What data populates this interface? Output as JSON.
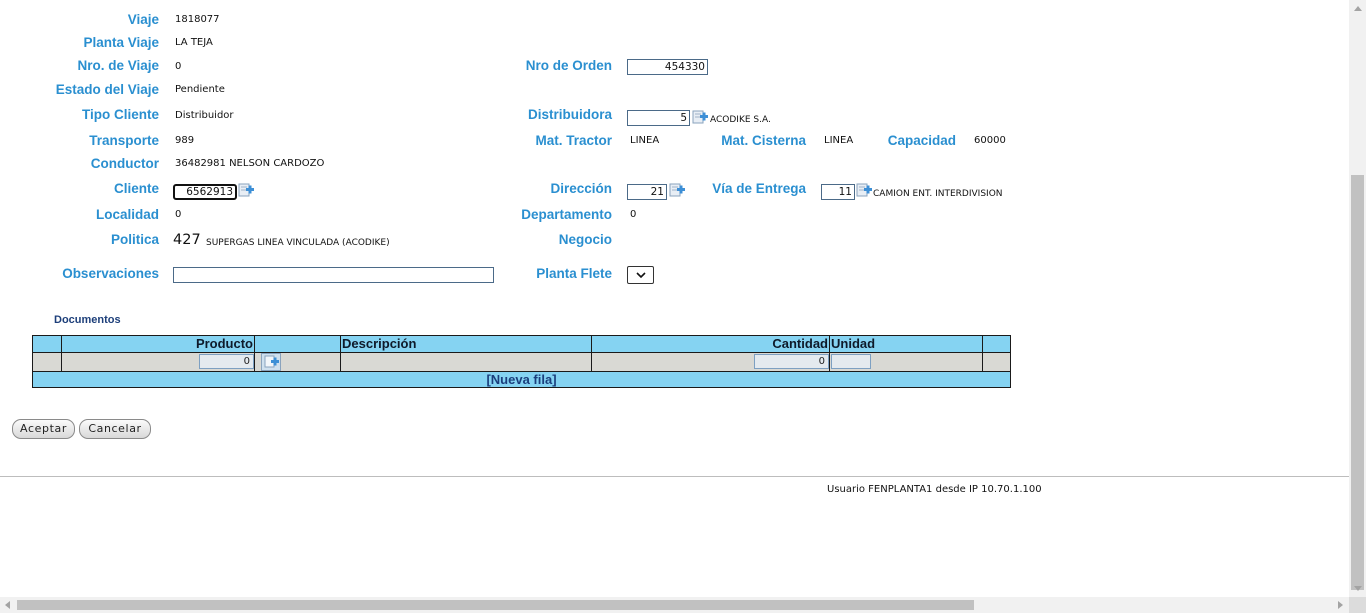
{
  "form": {
    "viaje": {
      "label": "Viaje",
      "value": "1818077"
    },
    "planta_viaje": {
      "label": "Planta Viaje",
      "value": "LA TEJA"
    },
    "nro_viaje": {
      "label": "Nro. de Viaje",
      "value": "0"
    },
    "nro_orden": {
      "label": "Nro de Orden",
      "value": "454330"
    },
    "estado": {
      "label": "Estado del Viaje",
      "value": "Pendiente"
    },
    "tipo_cliente": {
      "label": "Tipo Cliente",
      "value": "Distribuidor"
    },
    "distribuidora": {
      "label": "Distribuidora",
      "value": "5",
      "name": "ACODIKE S.A."
    },
    "transporte": {
      "label": "Transporte",
      "value": "989"
    },
    "mat_tractor": {
      "label": "Mat. Tractor",
      "value": "LINEA"
    },
    "mat_cisterna": {
      "label": "Mat. Cisterna",
      "value": "LINEA"
    },
    "capacidad": {
      "label": "Capacidad",
      "value": "60000"
    },
    "conductor": {
      "label": "Conductor",
      "value": "36482981 NELSON CARDOZO"
    },
    "cliente": {
      "label": "Cliente",
      "value": "6562913"
    },
    "direccion": {
      "label": "Dirección",
      "value": "21"
    },
    "via_entrega": {
      "label": "Vía de Entrega",
      "value": "11",
      "name": "CAMION ENT. INTERDIVISION"
    },
    "localidad": {
      "label": "Localidad",
      "value": "0"
    },
    "departamento": {
      "label": "Departamento",
      "value": "0"
    },
    "politica": {
      "label": "Politica",
      "code": "427",
      "name": "SUPERGAS LINEA VINCULADA (ACODIKE)"
    },
    "negocio": {
      "label": "Negocio",
      "value": ""
    },
    "observaciones": {
      "label": "Observaciones",
      "value": ""
    },
    "planta_flete": {
      "label": "Planta Flete",
      "selected": ""
    }
  },
  "documentos": {
    "title": "Documentos",
    "columns": {
      "producto": "Producto",
      "descripcion": "Descripción",
      "cantidad": "Cantidad",
      "unidad": "Unidad"
    },
    "rows": [
      {
        "producto": "0",
        "descripcion": "",
        "cantidad": "0",
        "unidad": ""
      }
    ],
    "new_row_label": "[Nueva fila]"
  },
  "buttons": {
    "accept": "Aceptar",
    "cancel": "Cancelar"
  },
  "footer": {
    "user_info": "Usuario FENPLANTA1 desde IP 10.70.1.100"
  },
  "icons": {
    "lookup": "lookup-add-icon"
  },
  "colors": {
    "label": "#2a8fd0",
    "grid_header": "#85d3f2",
    "grid_row": "#d9d9d4",
    "link": "#1b3f7d"
  }
}
